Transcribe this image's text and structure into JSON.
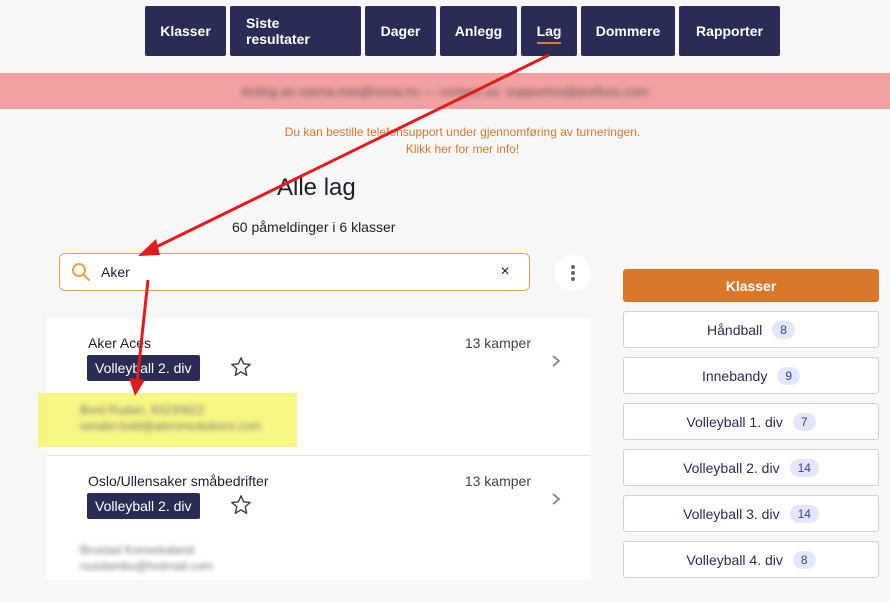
{
  "nav": [
    {
      "label": "Klasser"
    },
    {
      "label": "Siste resultater"
    },
    {
      "label": "Dager"
    },
    {
      "label": "Anlegg"
    },
    {
      "label": "Lag"
    },
    {
      "label": "Dommere"
    },
    {
      "label": "Rapporter"
    }
  ],
  "banner": {
    "text": "Acting as navna.noe@nona.no — contact us: supportno@prefoos.com"
  },
  "notice": {
    "line1": "Du kan bestille telefonsupport under gjennomføring av turneringen.",
    "line2": "Klikk her for mer info!"
  },
  "page": {
    "title": "Alle lag",
    "subtitle": "60 påmeldinger i 6 klasser"
  },
  "search": {
    "value": "Aker",
    "clear": "×"
  },
  "teams": [
    {
      "name": "Aker Aces",
      "division": "Volleyball 2. div",
      "matches": "13 kamper",
      "contact1": "Bord Rudan, 93230822",
      "contact2": "sender.bold@aleronsolutions.com"
    },
    {
      "name": "Oslo/Ullensaker småbedrifter",
      "division": "Volleyball 2. div",
      "matches": "13 kamper",
      "contact1": "Brustad Konsekaland",
      "contact2": "nusdambu@hotmail.com"
    }
  ],
  "sidebar": {
    "header": "Klasser",
    "items": [
      {
        "label": "Håndball",
        "count": "8"
      },
      {
        "label": "Innebandy",
        "count": "9"
      },
      {
        "label": "Volleyball 1. div",
        "count": "7"
      },
      {
        "label": "Volleyball 2. div",
        "count": "14"
      },
      {
        "label": "Volleyball 3. div",
        "count": "14"
      },
      {
        "label": "Volleyball 4. div",
        "count": "8"
      }
    ]
  },
  "colors": {
    "navy": "#2a2c55",
    "accent": "#d9782a",
    "banner": "#f3a0a2",
    "annotation_arrow": "#e31b1b",
    "highlight": "#f5f56d"
  }
}
